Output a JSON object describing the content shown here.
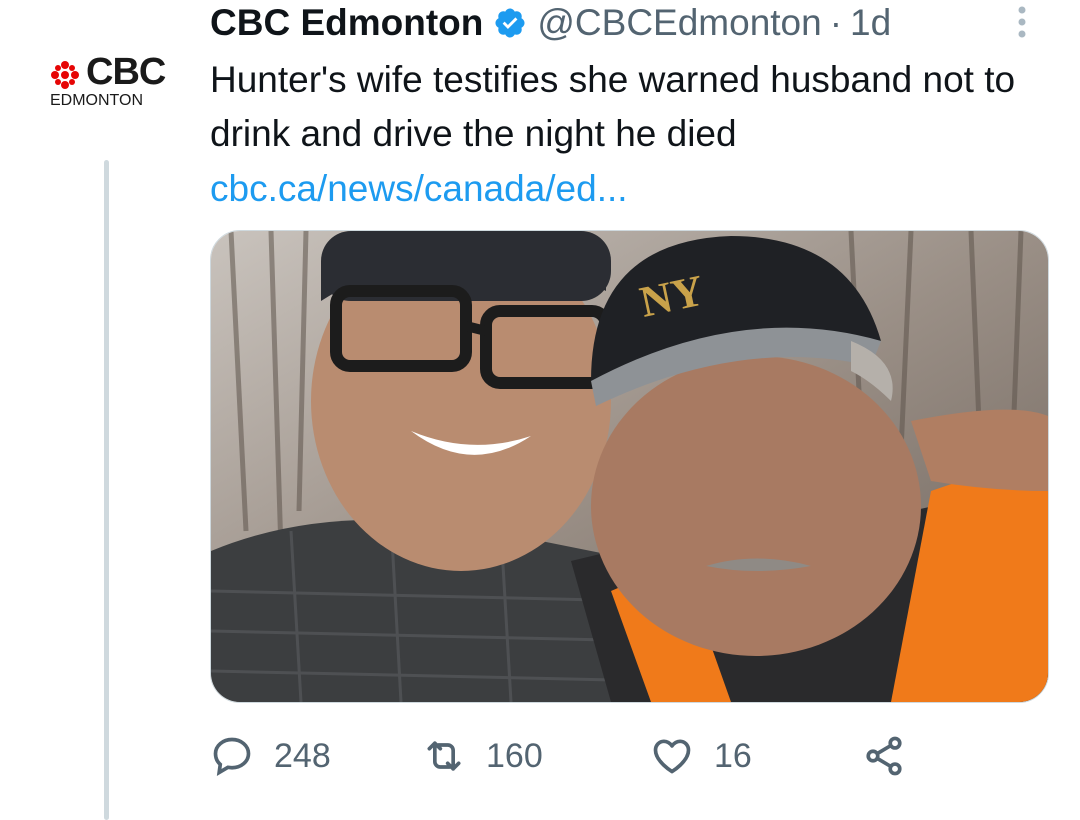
{
  "colors": {
    "text": "#0f1419",
    "muted": "#536471",
    "link": "#1d9bf0",
    "verified": "#1d9bf0",
    "thread_line": "#cfd9de",
    "cbc_red": "#e60505"
  },
  "avatar": {
    "brand": "CBC",
    "sub": "EDMONTON",
    "icon": "cbc-gem-icon"
  },
  "tweet": {
    "display_name": "CBC Edmonton",
    "verified_icon": "verified-badge-icon",
    "handle": "@CBCEdmonton",
    "separator": "·",
    "time": "1d",
    "text": "Hunter's wife testifies she warned husband not to drink and drive the night he died",
    "link": "cbc.ca/news/canada/ed...",
    "media_icon": "photo-two-men-selfie"
  },
  "actions": {
    "reply": {
      "icon": "reply-icon",
      "count": "248"
    },
    "retweet": {
      "icon": "retweet-icon",
      "count": "160"
    },
    "like": {
      "icon": "heart-icon",
      "count": "16"
    },
    "share": {
      "icon": "share-icon"
    }
  }
}
